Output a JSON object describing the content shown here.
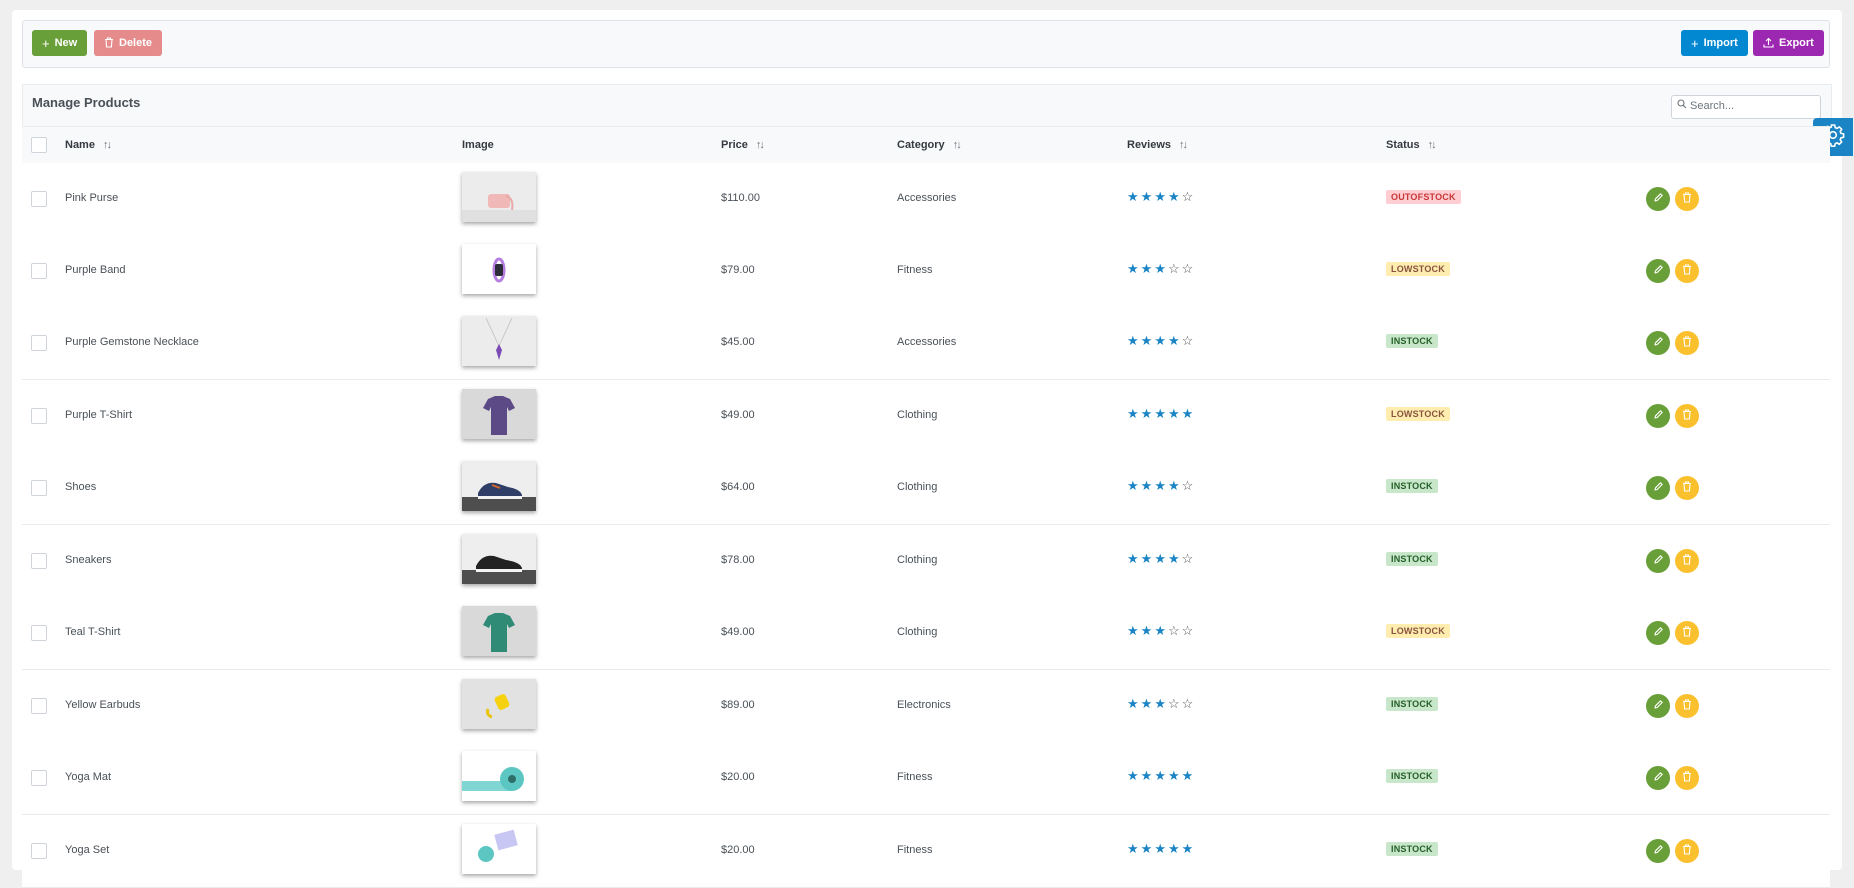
{
  "toolbar": {
    "new_label": "New",
    "delete_label": "Delete",
    "import_label": "Import",
    "export_label": "Export"
  },
  "table": {
    "title": "Manage Products",
    "search_placeholder": "Search...",
    "columns": [
      "Name",
      "Image",
      "Price",
      "Category",
      "Reviews",
      "Status"
    ],
    "rows": [
      {
        "name": "Pink Purse",
        "image": "pink-purse-photo",
        "price": "$110.00",
        "category": "Accessories",
        "rating": 4,
        "status": "OUTOFSTOCK"
      },
      {
        "name": "Purple Band",
        "image": "purple-band-photo",
        "price": "$79.00",
        "category": "Fitness",
        "rating": 3,
        "status": "LOWSTOCK"
      },
      {
        "name": "Purple Gemstone Necklace",
        "image": "purple-necklace-photo",
        "price": "$45.00",
        "category": "Accessories",
        "rating": 4,
        "status": "INSTOCK"
      },
      {
        "name": "Purple T-Shirt",
        "image": "purple-tshirt-photo",
        "price": "$49.00",
        "category": "Clothing",
        "rating": 5,
        "status": "LOWSTOCK"
      },
      {
        "name": "Shoes",
        "image": "shoes-photo",
        "price": "$64.00",
        "category": "Clothing",
        "rating": 4,
        "status": "INSTOCK"
      },
      {
        "name": "Sneakers",
        "image": "sneakers-photo",
        "price": "$78.00",
        "category": "Clothing",
        "rating": 4,
        "status": "INSTOCK"
      },
      {
        "name": "Teal T-Shirt",
        "image": "teal-tshirt-photo",
        "price": "$49.00",
        "category": "Clothing",
        "rating": 3,
        "status": "LOWSTOCK"
      },
      {
        "name": "Yellow Earbuds",
        "image": "yellow-earbuds-photo",
        "price": "$89.00",
        "category": "Electronics",
        "rating": 3,
        "status": "INSTOCK"
      },
      {
        "name": "Yoga Mat",
        "image": "yoga-mat-photo",
        "price": "$20.00",
        "category": "Fitness",
        "rating": 5,
        "status": "INSTOCK"
      },
      {
        "name": "Yoga Set",
        "image": "yoga-set-photo",
        "price": "$20.00",
        "category": "Fitness",
        "rating": 5,
        "status": "INSTOCK"
      }
    ]
  },
  "colors": {
    "new": "#689f38",
    "delete": "#e58b8b",
    "import": "#0288d1",
    "export": "#9c27b0",
    "star": "#1a84c4",
    "edit_action": "#689f38",
    "delete_action": "#fbc02d",
    "status": {
      "OUTOFSTOCK": {
        "bg": "#ffcdd2",
        "fg": "#c63737"
      },
      "LOWSTOCK": {
        "bg": "#feedaf",
        "fg": "#8a5340"
      },
      "INSTOCK": {
        "bg": "#c8e6c9",
        "fg": "#256029"
      }
    }
  },
  "icons": {
    "new": "plus-icon",
    "delete": "trash-icon",
    "import": "plus-icon",
    "export": "upload-icon",
    "search": "search-icon",
    "settings": "gear-icon",
    "sort": "sort-icon",
    "edit": "pencil-icon",
    "row_delete": "trash-icon",
    "rating": "star-icon"
  }
}
